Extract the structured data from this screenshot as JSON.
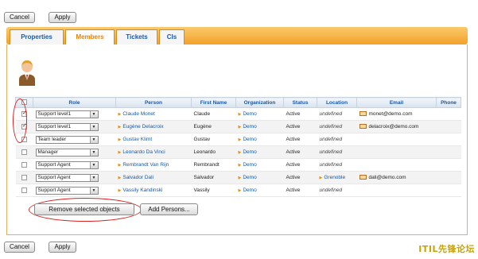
{
  "toolbar": {
    "cancel_label": "Cancel",
    "apply_label": "Apply"
  },
  "tabs": [
    {
      "label": "Properties",
      "active": false
    },
    {
      "label": "Members",
      "active": true
    },
    {
      "label": "Tickets",
      "active": false
    },
    {
      "label": "CIs",
      "active": false
    }
  ],
  "table": {
    "columns": [
      "Role",
      "Person",
      "First Name",
      "Organization",
      "Status",
      "Location",
      "Email",
      "Phone"
    ],
    "rows": [
      {
        "checked": true,
        "role": "Support level1",
        "person": "Claude Monet",
        "first_name": "Claude",
        "organization": "Demo",
        "status": "Active",
        "location": "undefined",
        "email": "monet@demo.com",
        "phone": ""
      },
      {
        "checked": true,
        "role": "Support level1",
        "person": "Eugène Delacroix",
        "first_name": "Eugène",
        "organization": "Demo",
        "status": "Active",
        "location": "undefined",
        "email": "delacroix@demo.com",
        "phone": ""
      },
      {
        "checked": false,
        "role": "Team leader",
        "person": "Gustav Klimt",
        "first_name": "Gustav",
        "organization": "Demo",
        "status": "Active",
        "location": "undefined",
        "email": "",
        "phone": ""
      },
      {
        "checked": false,
        "role": "Manager",
        "person": "Leonardo Da Vinci",
        "first_name": "Leonardo",
        "organization": "Demo",
        "status": "Active",
        "location": "undefined",
        "email": "",
        "phone": ""
      },
      {
        "checked": false,
        "role": "Support Agent",
        "person": "Rembrandt Van Rijn",
        "first_name": "Rembrandt",
        "organization": "Demo",
        "status": "Active",
        "location": "undefined",
        "email": "",
        "phone": ""
      },
      {
        "checked": false,
        "role": "Support Agent",
        "person": "Salvador Dali",
        "first_name": "Salvador",
        "organization": "Demo",
        "status": "Active",
        "location": "Grenoble",
        "email": "dali@demo.com",
        "phone": ""
      },
      {
        "checked": false,
        "role": "Support Agent",
        "person": "Vassily Kandinski",
        "first_name": "Vassily",
        "organization": "Demo",
        "status": "Active",
        "location": "undefined",
        "email": "",
        "phone": ""
      }
    ]
  },
  "actions": {
    "remove_label": "Remove selected objects",
    "add_label": "Add Persons..."
  },
  "watermark": "ITIL先锋论坛",
  "colors": {
    "tab_bar": "#f2a12a",
    "link": "#1a58a8",
    "active_tab_text": "#f07d00",
    "highlight_ring": "#d8211f"
  }
}
